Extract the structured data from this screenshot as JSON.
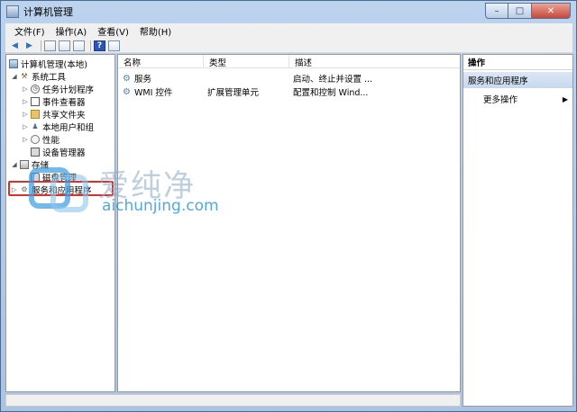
{
  "window": {
    "title": "计算机管理"
  },
  "menubar": [
    "文件(F)",
    "操作(A)",
    "查看(V)",
    "帮助(H)"
  ],
  "tree": {
    "root": "计算机管理(本地)",
    "system_tools": "系统工具",
    "task_scheduler": "任务计划程序",
    "event_viewer": "事件查看器",
    "shared_folders": "共享文件夹",
    "local_users": "本地用户和组",
    "performance": "性能",
    "device_manager": "设备管理器",
    "storage": "存储",
    "disk_management": "磁盘管理",
    "services_apps": "服务和应用程序"
  },
  "list": {
    "columns": [
      "名称",
      "类型",
      "描述"
    ],
    "rows": [
      {
        "name": "服务",
        "type": "",
        "desc": "启动、终止并设置 ..."
      },
      {
        "name": "WMI 控件",
        "type": "扩展管理单元",
        "desc": "配置和控制 Wind..."
      }
    ]
  },
  "actions": {
    "header": "操作",
    "section": "服务和应用程序",
    "more": "更多操作"
  },
  "watermark": {
    "text": "爱纯净",
    "url": "aichunjing.com"
  },
  "colors": {
    "highlight": "#d7312a",
    "action_section_bg": "#c7d8ee"
  }
}
